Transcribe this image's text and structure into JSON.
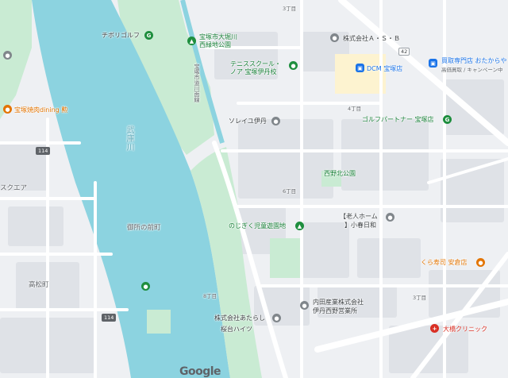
{
  "map": {
    "labels": {
      "chibori_golf": "チボリゴルフ",
      "oohorigawa_park": "宝塚市大堀川",
      "oohorigawa_park2": "西緑地公園",
      "tennis_school": "テニススクール・",
      "tennis_school2": "ノア 宝塚伊丹校",
      "sorei_itami": "ソレイユ伊丹",
      "company_asb": "株式会社Ａ・Ｓ・Ｂ",
      "dcm": "DCM 宝塚店",
      "kaitori": "買取専門店 おたからや",
      "kaitori_sub": "高価買取 / キャンペーン中",
      "golf_partner": "ゴルフパートナー 宝塚店",
      "nishino_park": "西野北公園",
      "rojin_home": "【老人ホーム",
      "rojin_home2": "】小春日和",
      "nojigiku": "のじぎく児童遊園地",
      "kura_sushi": "くら寿司 安倉店",
      "uchida": "内田産業株式会社",
      "uchida2": "伊丹西野営業所",
      "atarashi": "株式会社あたらし",
      "sakuradai": "桜台ハイツ",
      "ohashi": "大橋クリニック",
      "yakiniku": "宝塚焼肉dining 勲",
      "square": "スクエア",
      "goshonomae": "御所の前町",
      "takamatsu": "高松町",
      "muko_river": "武庫川",
      "street_name": "宝塚市道川面線",
      "chome3": "3丁目",
      "chome4": "4丁目",
      "chome6": "6丁目",
      "chome8": "8丁目",
      "chome3b": "3丁目",
      "shield114a": "114",
      "shield114b": "114",
      "shield42": "42",
      "google": "Google"
    },
    "colors": {
      "river": "#8cd3e0",
      "park": "#c9ebd3",
      "road": "#ffffff",
      "land": "#eef0f3",
      "block": "#dfe2e7"
    }
  }
}
